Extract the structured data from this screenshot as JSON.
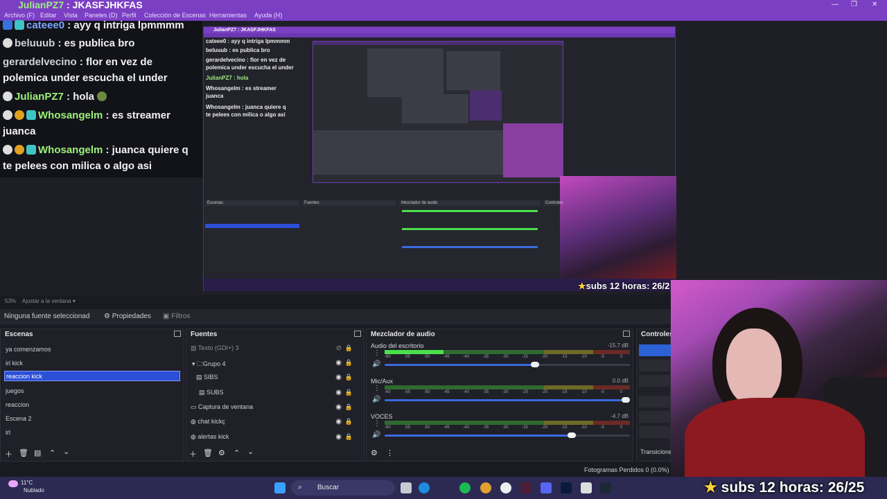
{
  "window": {
    "title_user": "JulianPZ7",
    "title_rest": ": JKASFJHKFAS",
    "controls": [
      "—",
      "❐",
      "✕"
    ]
  },
  "menu": [
    "Archivo (F)",
    "Editar",
    "Vista",
    "Paneles (D)",
    "Perfil",
    "Colección de Escenas",
    "Herramientas",
    "Ayuda (H)"
  ],
  "chat": [
    {
      "name": "cateee0",
      "text": ": ayy q intriga lpmmmm"
    },
    {
      "name": "beluuub",
      "text": ": es publica bro"
    },
    {
      "name": "gerardelvecino",
      "text": ": flor en vez de"
    },
    {
      "name": "",
      "text": "polemica under escucha el under"
    },
    {
      "name": "JulianPZ7",
      "text": ": hola"
    },
    {
      "name": "Whosangelm",
      "text": ": es streamer"
    },
    {
      "name": "",
      "text": "juanca"
    },
    {
      "name": "Whosangelm",
      "text": ": juanca quiere q"
    },
    {
      "name": "",
      "text": "te pelees con milica o algo asi"
    }
  ],
  "nested": {
    "title": "JulianPZ7 : JKASFJHKFAS",
    "chat": [
      "cateee0 : ayy q intriga lpmmmm",
      "beluuub : es publica bro",
      "gerardelvecino : flor en vez de",
      "polemica under escucha el under",
      "JulianPZ7 : hola",
      "Whosangelm : es streamer",
      "juanca",
      "Whosangelm : juanca quiere q",
      "te pelees con milica o algo asi"
    ],
    "panels": [
      "Escenas",
      "Fuentes",
      "Mezclador de audio",
      "Controles"
    ]
  },
  "preview_status": {
    "zoom": "53%",
    "fit": "Ajustar a la ventana"
  },
  "overlay": {
    "subs": "subs 12 horas: 26/25",
    "subs_small": "subs 12 horas: 26/2"
  },
  "properties_bar": {
    "no_source": "Ninguna fuente seleccionad",
    "properties": "Propiedades",
    "filters": "Filtros"
  },
  "scenes": {
    "title": "Escenas",
    "items": [
      "ya comenzamos",
      "irl kick",
      "reaccion kick",
      "juegos",
      "reaccion",
      "Escena 2",
      "irl"
    ],
    "selected": "reaccion kick"
  },
  "sources": {
    "title": "Fuentes",
    "items": [
      "Texto (GDI+) 3",
      "Grupo 4",
      "SIBS",
      "SUBS",
      "Captura de ventana",
      "chat kickç",
      "alertas kick"
    ]
  },
  "mixer": {
    "title": "Mezclador de audio",
    "channels": [
      {
        "name": "Audio del escritorio",
        "db": "-15.7 dB",
        "level": 0.24,
        "volume": 0.63
      },
      {
        "name": "Mic/Aux",
        "db": "0.0 dB",
        "level": 0.0,
        "volume": 1.0
      },
      {
        "name": "VOCES",
        "db": "-4.7 dB",
        "level": 0.0,
        "volume": 0.78
      }
    ],
    "ticks": [
      "-60",
      "-55",
      "-50",
      "-45",
      "-40",
      "-35",
      "-30",
      "-25",
      "-20",
      "-15",
      "-10",
      "-5",
      "0"
    ]
  },
  "controls": {
    "title": "Controles",
    "transitions": "Transicione"
  },
  "status": {
    "frames": "Fotogramas Perdidos 0 (0.0%)"
  },
  "taskbar": {
    "temp": "11°C",
    "condition": "Nublado",
    "search": "Buscar"
  },
  "colors": {
    "accent": "#7b3fc4",
    "selection": "#2b4fd6",
    "chat_name": "#9ef07b",
    "meter_green": "#4ae04a"
  }
}
